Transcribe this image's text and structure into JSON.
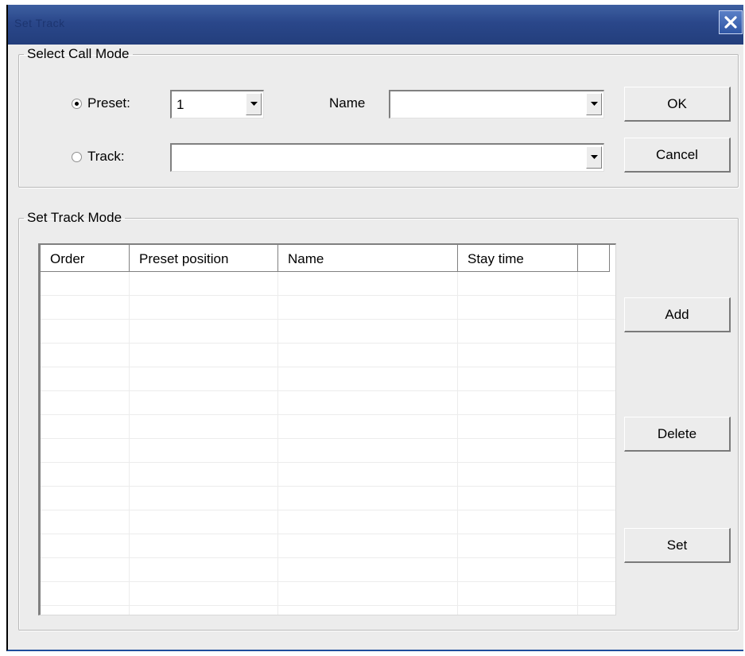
{
  "window": {
    "title": "Set Track"
  },
  "call_mode": {
    "legend": "Select Call Mode",
    "preset_label": "Preset:",
    "preset_value": "1",
    "name_label": "Name",
    "name_value": "",
    "track_label": "Track:",
    "track_value": "",
    "selected_mode": "preset",
    "ok_label": "OK",
    "cancel_label": "Cancel"
  },
  "track_mode": {
    "legend": "Set Track Mode",
    "columns": [
      "Order",
      "Preset position",
      "Name",
      "Stay time",
      ""
    ],
    "rows": [],
    "add_label": "Add",
    "delete_label": "Delete",
    "set_label": "Set"
  },
  "icons": {
    "close": "close-icon",
    "dropdown": "chevron-down-icon",
    "radio": "radio-icon"
  },
  "colors": {
    "titlebar": "#2a478a",
    "dialog_bg": "#ececec",
    "list_bg": "#ffffff"
  }
}
